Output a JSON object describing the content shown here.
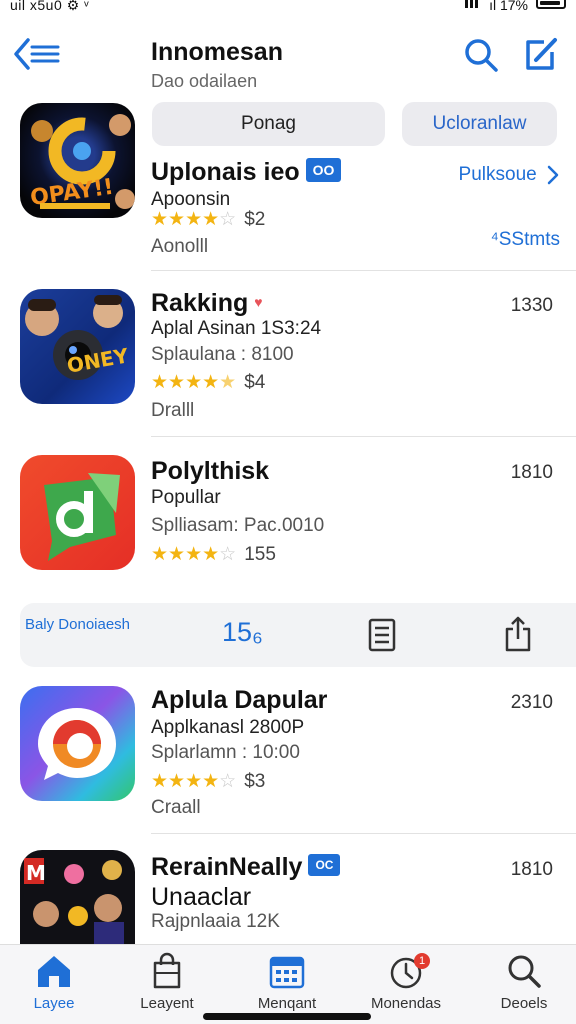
{
  "status_bar": {
    "left": "uil x5u0 ⚙ ᵛ",
    "right": "ıl 17%"
  },
  "header": {
    "title": "Innomesan",
    "subtitle": "Dao odailaen"
  },
  "pills": [
    "Ponag",
    "Ucloranlaw"
  ],
  "apps": [
    {
      "title": "Uplonais ieo",
      "badge": "OO",
      "lines": [
        "Apoonsin"
      ],
      "rating": 4,
      "price": "$2",
      "sub": "Aonolll",
      "link": "Pulksoue",
      "link2": "⁴SStmts"
    },
    {
      "title": "Rakking",
      "lines": [
        "Aplal Asinan 1S3:24",
        "Splaulana : 8100"
      ],
      "rating": 4.5,
      "price": "$4",
      "sub": "Dralll",
      "right": "1330"
    },
    {
      "title": "Polylthisk",
      "lines": [
        "Popullar",
        "Splliasam: Pac.0010"
      ],
      "rating": 4,
      "price": "155",
      "right": "1810"
    },
    {
      "title": "Aplula Dapular",
      "lines": [
        "Applkanasl 2800P",
        "Splarlamn : 10:00"
      ],
      "rating": 4,
      "price": "$3",
      "sub": "Craall",
      "right": "2310"
    },
    {
      "title": "RerainNeally",
      "badge": "OC",
      "lines": [
        "Unaaclar",
        "Rajpnlaaia 12K"
      ],
      "right": "1810"
    }
  ],
  "toolbar": {
    "label": "Baly Donoiaesh",
    "number": "15₆"
  },
  "tabs": [
    {
      "label": "Layee",
      "icon": "home-icon"
    },
    {
      "label": "Leayent",
      "icon": "bag-icon"
    },
    {
      "label": "Menqant",
      "icon": "calendar-icon"
    },
    {
      "label": "Monendas",
      "icon": "clock-icon",
      "badge": "1"
    },
    {
      "label": "Deoels",
      "icon": "search-icon"
    }
  ],
  "colors": {
    "accent": "#1f6fd6",
    "star": "#f3b412"
  }
}
